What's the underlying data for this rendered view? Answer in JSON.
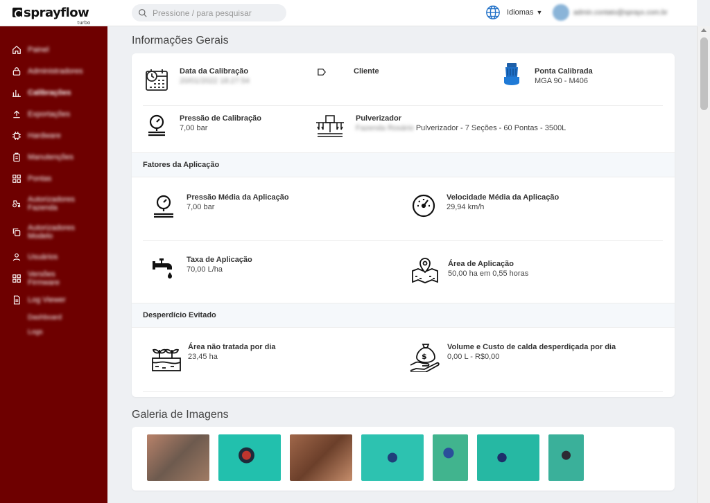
{
  "brand": {
    "name": "sprayflow",
    "sub": "turbo"
  },
  "header": {
    "search_placeholder": "Pressione / para pesquisar",
    "language_label": "Idiomas",
    "user_email": "admin.contato@sprayx.com.br"
  },
  "sidebar": {
    "items": [
      {
        "label": "Painel",
        "icon": "home-icon"
      },
      {
        "label": "Administradores",
        "icon": "lock-icon"
      },
      {
        "label": "Calibrações",
        "icon": "bar-chart-icon"
      },
      {
        "label": "Exportações",
        "icon": "upload-icon"
      },
      {
        "label": "Hardware",
        "icon": "chip-icon"
      },
      {
        "label": "Manutenções",
        "icon": "clipboard-icon"
      },
      {
        "label": "Pontas",
        "icon": "grid-icon"
      },
      {
        "label": "Autorizadores Fazenda",
        "icon": "tractor-icon"
      },
      {
        "label": "Autorizadores Modelo",
        "icon": "copy-icon"
      },
      {
        "label": "Usuários",
        "icon": "user-icon"
      },
      {
        "label": "Versões Firmware",
        "icon": "grid-icon"
      },
      {
        "label": "Log Viewer",
        "icon": "file-icon"
      }
    ],
    "sub_items": [
      "Dashboard",
      "Logs"
    ]
  },
  "info": {
    "title": "Informações Gerais",
    "calibration_date": {
      "label": "Data da Calibração",
      "value": "20/01/2022 18:27:54"
    },
    "client": {
      "label": "Cliente",
      "value": ""
    },
    "nozzle": {
      "label": "Ponta Calibrada",
      "value": "MGA 90 - M406"
    },
    "pressure": {
      "label": "Pressão de Calibração",
      "value": "7,00 bar"
    },
    "sprayer": {
      "label": "Pulverizador",
      "value_hidden": "Fazenda Rosário",
      "value": "Pulverizador - 7 Seções - 60 Pontas - 3500L"
    }
  },
  "factors": {
    "title": "Fatores da Aplicação",
    "avg_pressure": {
      "label": "Pressão Média da Aplicação",
      "value": "7,00 bar"
    },
    "avg_speed": {
      "label": "Velocidade Média da Aplicação",
      "value": "29,94 km/h"
    },
    "rate": {
      "label": "Taxa de Aplicação",
      "value": "70,00 L/ha"
    },
    "area": {
      "label": "Área de Aplicação",
      "value": "50,00 ha em 0,55 horas"
    }
  },
  "waste": {
    "title": "Desperdício Evitado",
    "untreated": {
      "label": "Área não tratada por dia",
      "value": "23,45 ha"
    },
    "volume_cost": {
      "label": "Volume e Custo de calda desperdiçada por dia",
      "value": "0,00 L - R$0,00"
    }
  },
  "gallery": {
    "title": "Galeria de Imagens",
    "images": [
      {
        "name": "gallery-image-1",
        "color": "#8a6d5a"
      },
      {
        "name": "gallery-image-2",
        "color": "#23b8a5"
      },
      {
        "name": "gallery-image-3",
        "color": "#8b5a3c"
      },
      {
        "name": "gallery-image-4",
        "color": "#2dbfae"
      },
      {
        "name": "gallery-image-5",
        "color": "#3fae8c"
      },
      {
        "name": "gallery-image-6",
        "color": "#22b3a0"
      },
      {
        "name": "gallery-image-7",
        "color": "#3aa88f"
      }
    ]
  },
  "colors": {
    "sidebar": "#6e0000",
    "accent_blue": "#1e6fc7"
  }
}
